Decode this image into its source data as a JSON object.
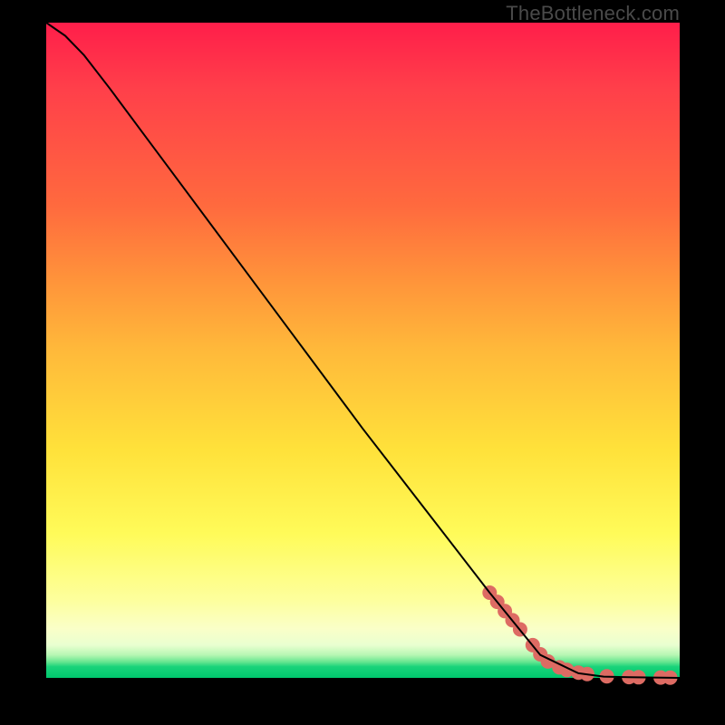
{
  "watermark": "TheBottleneck.com",
  "chart_data": {
    "type": "line",
    "title": "",
    "xlabel": "",
    "ylabel": "",
    "xlim": [
      0,
      100
    ],
    "ylim": [
      0,
      100
    ],
    "grid": false,
    "legend": false,
    "series": [
      {
        "name": "curve",
        "color": "#000000",
        "x": [
          0,
          3,
          6,
          10,
          15,
          20,
          30,
          40,
          50,
          60,
          70,
          78,
          84,
          88,
          92,
          96,
          100
        ],
        "values": [
          100,
          98,
          95,
          90,
          83.5,
          77,
          64,
          51,
          38,
          25.5,
          13,
          3.5,
          0.7,
          0.2,
          0.1,
          0.05,
          0
        ]
      }
    ],
    "markers": {
      "name": "highlight-dots",
      "color": "#dd6b63",
      "radius_px": 8,
      "points": [
        {
          "x": 70.0,
          "y": 13.0
        },
        {
          "x": 71.2,
          "y": 11.6
        },
        {
          "x": 72.4,
          "y": 10.2
        },
        {
          "x": 73.6,
          "y": 8.8
        },
        {
          "x": 74.8,
          "y": 7.4
        },
        {
          "x": 76.8,
          "y": 5.0
        },
        {
          "x": 78.0,
          "y": 3.6
        },
        {
          "x": 79.2,
          "y": 2.5
        },
        {
          "x": 81.0,
          "y": 1.6
        },
        {
          "x": 82.2,
          "y": 1.2
        },
        {
          "x": 84.0,
          "y": 0.8
        },
        {
          "x": 85.4,
          "y": 0.6
        },
        {
          "x": 88.5,
          "y": 0.25
        },
        {
          "x": 92.0,
          "y": 0.12
        },
        {
          "x": 93.5,
          "y": 0.1
        },
        {
          "x": 97.0,
          "y": 0.05
        },
        {
          "x": 98.5,
          "y": 0.04
        }
      ]
    }
  }
}
